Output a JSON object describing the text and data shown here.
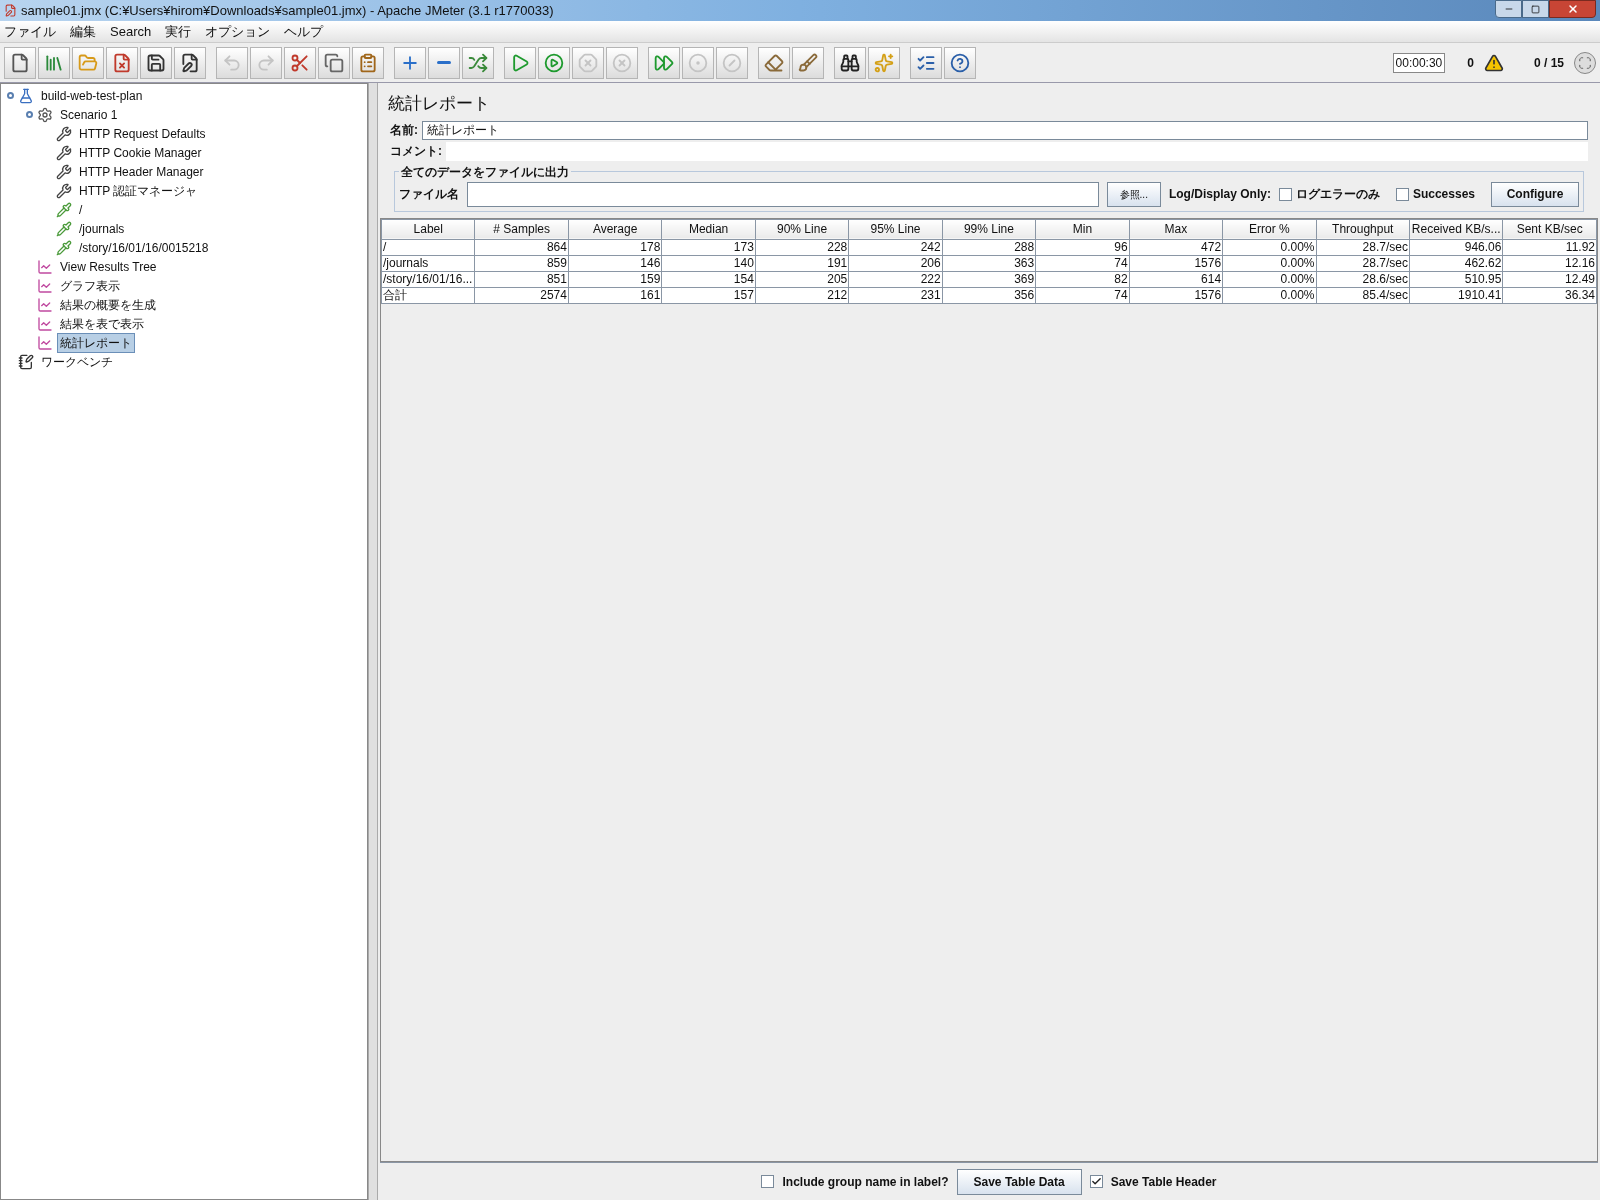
{
  "window": {
    "title": "sample01.jmx (C:¥Users¥hirom¥Downloads¥sample01.jmx) - Apache JMeter (3.1 r1770033)"
  },
  "menu": [
    "ファイル",
    "編集",
    "Search",
    "実行",
    "オプション",
    "ヘルプ"
  ],
  "toolbar": [
    [
      {
        "kind": "new",
        "disabled": false
      },
      {
        "kind": "templates",
        "disabled": false
      },
      {
        "kind": "open",
        "disabled": false
      },
      {
        "kind": "close",
        "disabled": false
      },
      {
        "kind": "save",
        "disabled": false
      },
      {
        "kind": "saveas",
        "disabled": false
      }
    ],
    [
      {
        "kind": "undo",
        "disabled": true
      },
      {
        "kind": "redo",
        "disabled": true
      },
      {
        "kind": "cut",
        "disabled": false
      },
      {
        "kind": "copy",
        "disabled": false
      },
      {
        "kind": "paste",
        "disabled": false
      }
    ],
    [
      {
        "kind": "expand",
        "disabled": false
      },
      {
        "kind": "collapse",
        "disabled": false
      },
      {
        "kind": "toggle",
        "disabled": false
      }
    ],
    [
      {
        "kind": "start",
        "disabled": false
      },
      {
        "kind": "startnopause",
        "disabled": false
      },
      {
        "kind": "stop",
        "disabled": true
      },
      {
        "kind": "shutdown",
        "disabled": true
      }
    ],
    [
      {
        "kind": "remotestart",
        "disabled": false
      },
      {
        "kind": "remotestop",
        "disabled": true
      },
      {
        "kind": "remoteexit",
        "disabled": true
      }
    ],
    [
      {
        "kind": "clear",
        "disabled": false
      },
      {
        "kind": "clearall",
        "disabled": false
      }
    ],
    [
      {
        "kind": "search",
        "disabled": false
      },
      {
        "kind": "resetsearch",
        "disabled": false
      }
    ],
    [
      {
        "kind": "functions",
        "disabled": false
      },
      {
        "kind": "help",
        "disabled": false
      }
    ]
  ],
  "status": {
    "timer": "00:00:30",
    "warnings": "0",
    "threads": "0 / 15"
  },
  "tree": [
    {
      "label": "build-web-test-plan",
      "kind": "testplan",
      "selected": false,
      "expanded": true,
      "children": [
        {
          "label": "Scenario 1",
          "kind": "threadgroup",
          "selected": false,
          "expanded": true,
          "children": [
            {
              "label": "HTTP Request Defaults",
              "kind": "config",
              "selected": false
            },
            {
              "label": "HTTP Cookie Manager",
              "kind": "config",
              "selected": false
            },
            {
              "label": "HTTP Header Manager",
              "kind": "config",
              "selected": false
            },
            {
              "label": "HTTP 認証マネージャ",
              "kind": "config",
              "selected": false
            },
            {
              "label": "/",
              "kind": "sampler",
              "selected": false
            },
            {
              "label": "/journals",
              "kind": "sampler",
              "selected": false
            },
            {
              "label": "/story/16/01/16/0015218",
              "kind": "sampler",
              "selected": false
            }
          ]
        },
        {
          "label": "View Results Tree",
          "kind": "listener",
          "selected": false
        },
        {
          "label": "グラフ表示",
          "kind": "listener",
          "selected": false
        },
        {
          "label": "結果の概要を生成",
          "kind": "listener",
          "selected": false
        },
        {
          "label": "結果を表で表示",
          "kind": "listener",
          "selected": false
        },
        {
          "label": "統計レポート",
          "kind": "listener",
          "selected": true
        }
      ]
    },
    {
      "label": "ワークベンチ",
      "kind": "workbench",
      "selected": false
    }
  ],
  "panel": {
    "title": "統計レポート",
    "name_label": "名前:",
    "name_value": "統計レポート",
    "comment_label": "コメント:",
    "file_group": "全てのデータをファイルに出力",
    "file_label": "ファイル名",
    "browse": "参照...",
    "log_label": "Log/Display Only:",
    "checks": [
      {
        "label": "ログエラーのみ",
        "checked": false
      },
      {
        "label": "Successes",
        "checked": false
      }
    ],
    "configure": "Configure"
  },
  "table": {
    "columns": [
      "Label",
      "# Samples",
      "Average",
      "Median",
      "90% Line",
      "95% Line",
      "99% Line",
      "Min",
      "Max",
      "Error %",
      "Throughput",
      "Received KB/s...",
      "Sent KB/sec"
    ],
    "rows": [
      [
        "/",
        "864",
        "178",
        "173",
        "228",
        "242",
        "288",
        "96",
        "472",
        "0.00%",
        "28.7/sec",
        "946.06",
        "11.92"
      ],
      [
        "/journals",
        "859",
        "146",
        "140",
        "191",
        "206",
        "363",
        "74",
        "1576",
        "0.00%",
        "28.7/sec",
        "462.62",
        "12.16"
      ],
      [
        "/story/16/01/16...",
        "851",
        "159",
        "154",
        "205",
        "222",
        "369",
        "82",
        "614",
        "0.00%",
        "28.6/sec",
        "510.95",
        "12.49"
      ],
      [
        "合計",
        "2574",
        "161",
        "157",
        "212",
        "231",
        "356",
        "74",
        "1576",
        "0.00%",
        "85.4/sec",
        "1910.41",
        "36.34"
      ]
    ]
  },
  "footer": {
    "group_check": {
      "label": "Include group name in label?",
      "checked": false
    },
    "save_button": "Save Table Data",
    "header_check": {
      "label": "Save Table Header",
      "checked": true
    }
  }
}
